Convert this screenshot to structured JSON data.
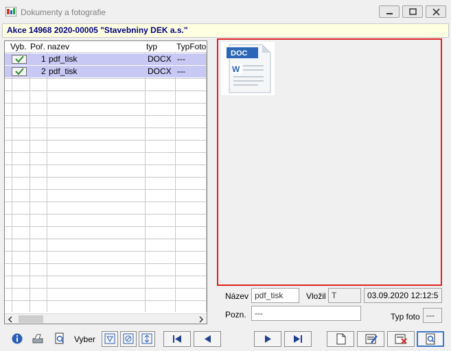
{
  "window": {
    "title": "Dokumenty a fotografie"
  },
  "header": {
    "text": "Akce 14968 2020-00005  \"Stavebniny DEK a.s.\""
  },
  "grid": {
    "columns": [
      "Vyb.",
      "Poř.",
      "nazev",
      "typ",
      "TypFoto"
    ],
    "rows": [
      {
        "selected": true,
        "order": "1",
        "name": "pdf_tisk",
        "type": "DOCX",
        "photo_type": "---"
      },
      {
        "selected": true,
        "order": "2",
        "name": "pdf_tisk",
        "type": "DOCX",
        "photo_type": "---"
      }
    ]
  },
  "preview": {
    "icon_label": "DOC",
    "icon_letter": "W"
  },
  "details": {
    "name_label": "Název",
    "name_value": "pdf_tisk",
    "inserted_label": "Vložil",
    "inserted_value": "T",
    "date_value": "03.09.2020 12:12:5",
    "note_label": "Pozn.",
    "note_value": "---",
    "photo_type_label": "Typ foto",
    "photo_type_value": "---"
  },
  "toolbar": {
    "select_label": "Vyber"
  },
  "colors": {
    "accent": "#000080",
    "selection": "#c8c8f4",
    "preview_border": "#e02020",
    "header_bg": "#ffffe1"
  }
}
